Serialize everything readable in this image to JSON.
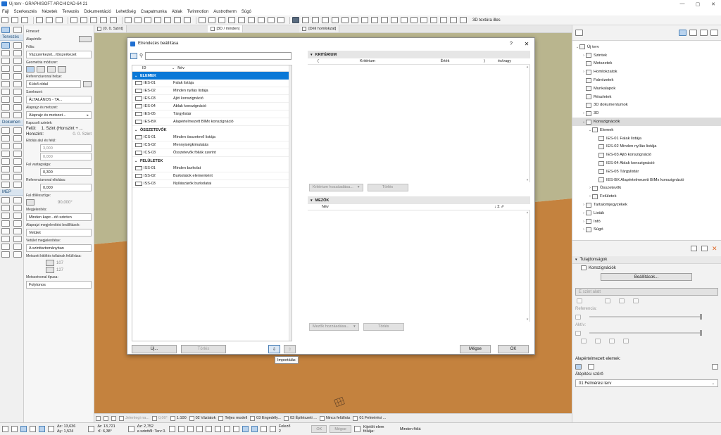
{
  "window": {
    "title": "Új terv - GRAPHISOFT ARCHICAD-64 21",
    "controls": [
      "—",
      "▢",
      "✕"
    ]
  },
  "menubar": [
    "Fájl",
    "Szerkesztés",
    "Nézetek",
    "Tervezés",
    "Dokumentáció",
    "Lehetőség",
    "Csapatmunka",
    "Ablak",
    "Twinmotion",
    "Austrotherm",
    "Súgó"
  ],
  "toolbar": {
    "right_label": "3D textúra illes"
  },
  "toolbox": {
    "groups": [
      {
        "title": "Tervezés"
      },
      {
        "title": "Dokumen"
      },
      {
        "title": "MEP"
      }
    ]
  },
  "infobox": {
    "labels": {
      "fimeset": "Fímeset:",
      "alapertek": "Alapérték:",
      "fal_label": "Fólia:",
      "fal_value": "Vázszerkezet...rtószerkezet",
      "geometria": "Geometria módszer:",
      "referencia": "Referenciavonal helye:",
      "referencia_value": "Külső oldal",
      "szerkezet": "Szerkezet:",
      "szerkezet_value": "ÁLTALÁNOS - TA...",
      "alaprajz": "Alaprajz és metszet:",
      "alaprajz_value": "Alaprajz és metszet...",
      "kapcsolt": "Kapcsolt szintek:",
      "felul": "Felül:",
      "felul_value": "1. Szint (Honszint + ...",
      "honszint": "Honszint:",
      "honszint_value": "0. 0. Szint",
      "elsosz": "Eltolás alul és felül:",
      "val1": "3,000",
      "val2": "0,000",
      "falvastagsag": "Fal vastagsága:",
      "falvastagsag_value": "0,300",
      "refvonal_eltolas": "Referenciavonal eltolása:",
      "refvonal_value": "0,000",
      "dolesszog": "Fal dőlésszöge:",
      "dolesszog_value": "90,000°",
      "megjelenites": "Megjelenítés:",
      "megjelenites_value": "Minden kapc...dó szinten",
      "alaprajzi_megj": "Alaprajzi megjelenítési beállítások:",
      "alaprajzi_value": "Vetület",
      "vetulet": "Vetület megjelenítése:",
      "vetulet_value": "A szinttartományban",
      "metszett": "Metszett kitöltés tollainak felülírása:",
      "metszett_v1": "107",
      "metszett_v2": "127",
      "vonaltipus": "Metszetvonal típusa:",
      "vonaltipus_value": "Folytonos"
    }
  },
  "viewtabs": [
    {
      "label": "[0. 0. Szint]",
      "active": false
    },
    {
      "label": "[3D / minden]",
      "active": true
    },
    {
      "label": "[Déli homlokzat]",
      "active": false
    }
  ],
  "navigator": {
    "items": [
      {
        "label": "Új terv",
        "level": 0,
        "tw": "⌄"
      },
      {
        "label": "Szintek",
        "level": 1,
        "tw": "›"
      },
      {
        "label": "Metszetek",
        "level": 1,
        "tw": ""
      },
      {
        "label": "Homlokzatok",
        "level": 1,
        "tw": "›"
      },
      {
        "label": "Falnézetek",
        "level": 1,
        "tw": ""
      },
      {
        "label": "Munkalapok",
        "level": 1,
        "tw": ""
      },
      {
        "label": "Részletek",
        "level": 1,
        "tw": ""
      },
      {
        "label": "3D dokumentumok",
        "level": 1,
        "tw": ""
      },
      {
        "label": "3D",
        "level": 1,
        "tw": "›"
      },
      {
        "label": "Konszignációk",
        "level": 1,
        "tw": "⌄",
        "sel": true
      },
      {
        "label": "Elemek",
        "level": 2,
        "tw": "⌄"
      },
      {
        "label": "IES-01 Falak listája",
        "level": 3,
        "tw": ""
      },
      {
        "label": "IES-02 Minden nyílás listája",
        "level": 3,
        "tw": ""
      },
      {
        "label": "IES-03 Ajtó konszignáció",
        "level": 3,
        "tw": ""
      },
      {
        "label": "IES-04 Ablak konszignáció",
        "level": 3,
        "tw": ""
      },
      {
        "label": "IES-05 Tárgylistár",
        "level": 3,
        "tw": ""
      },
      {
        "label": "IES-BX Alapértelmezett BIMx konszignáció",
        "level": 3,
        "tw": ""
      },
      {
        "label": "Összetevők",
        "level": 2,
        "tw": "›"
      },
      {
        "label": "Felületek",
        "level": 2,
        "tw": "›"
      },
      {
        "label": "Tartalomjegyzékek",
        "level": 1,
        "tw": "›"
      },
      {
        "label": "Listák",
        "level": 1,
        "tw": "›"
      },
      {
        "label": "Infó",
        "level": 1,
        "tw": "›"
      },
      {
        "label": "Súgó",
        "level": 1,
        "tw": "›"
      }
    ]
  },
  "props": {
    "title": "Tulajdonságok",
    "kind": "Konszignációk",
    "settings_button": "Beállítások...",
    "level_field": "E szint alatt",
    "referencia": "Referencia:",
    "aktiv": "Aktív:",
    "default_elem": "Alapértelmezett elemek:",
    "atepitesi": "Átépítési szűrő",
    "atepitesi_value": "01 Felmérési terv"
  },
  "statusbar": {
    "items": [
      "Jelenlegi na...",
      "0,00°",
      "1:100",
      "02 Vázlatok",
      "Teljes modell",
      "03 Engedély...",
      "03 Építészeti ...",
      "Nincs felülírás",
      "01 Felmérési ..."
    ]
  },
  "coordbar": {
    "ax": "Δx: 13,636",
    "ay": "Δy: 1,524",
    "ar": "Δr: 13,721",
    "aa": "∢: 6,38°",
    "az": "Δz: 2,752",
    "az_sub": "a szinttől: Terv 0.",
    "felezo": "Felező",
    "felezo_v": "2",
    "ok": "OK",
    "megse": "Mégse",
    "kijelolt": "Kijelölt elem fóliája:",
    "minden": "Minden fóliá"
  },
  "dialog": {
    "title": "Elrendezés beállítása",
    "help": "?",
    "close": "✕",
    "search_placeholder": "",
    "list_head": {
      "id": "ID",
      "name": "Név"
    },
    "groups": [
      {
        "name": "ELEMEK",
        "selected": true,
        "rows": [
          {
            "id": "IES-01",
            "name": "Falak listája"
          },
          {
            "id": "IES-02",
            "name": "Minden nyílás listája"
          },
          {
            "id": "IES-03",
            "name": "Ajtó konszignáció"
          },
          {
            "id": "IES-04",
            "name": "Ablak konszignáció"
          },
          {
            "id": "IES-05",
            "name": "Tárgylistár"
          },
          {
            "id": "IES-BX",
            "name": "Alapértelmezett BIMx konszignáció"
          }
        ]
      },
      {
        "name": "ÖSSZETEVŐK",
        "selected": false,
        "rows": [
          {
            "id": "ICS-01",
            "name": "Minden összetevő listája"
          },
          {
            "id": "ICS-02",
            "name": "Mennyiségkimutatás"
          },
          {
            "id": "ICS-03",
            "name": "Összetevők fóliák szerint"
          }
        ]
      },
      {
        "name": "FELÜLETEK",
        "selected": false,
        "rows": [
          {
            "id": "ISS-01",
            "name": "Minden burkolat"
          },
          {
            "id": "ISS-02",
            "name": "Burkolatok elemenként"
          },
          {
            "id": "ISS-03",
            "name": "Nyílászárók burkolatai"
          }
        ]
      }
    ],
    "criteria": {
      "title": "KRITÉRIUM",
      "cols": [
        "(",
        "Kritérium",
        "Érték",
        ")",
        "és/vagy"
      ],
      "add_button": "Kritérium hozzáadása...",
      "delete_button": "Törlés"
    },
    "fields": {
      "title": "MEZŐK",
      "col_name": "Név",
      "col_icons": "↓ Σ ⇗",
      "add_button": "Mezők hozzáadása...",
      "delete_button": "Törlés"
    },
    "footer": {
      "new_button": "Új...",
      "delete_button": "Törlés",
      "cancel_button": "Mégse",
      "ok_button": "OK"
    },
    "tooltip": "Importálás"
  },
  "colors": {
    "selection": "#0a78d7",
    "sky": "#ffffff",
    "wall": "#b9b58e",
    "ground": "#c4823e"
  }
}
